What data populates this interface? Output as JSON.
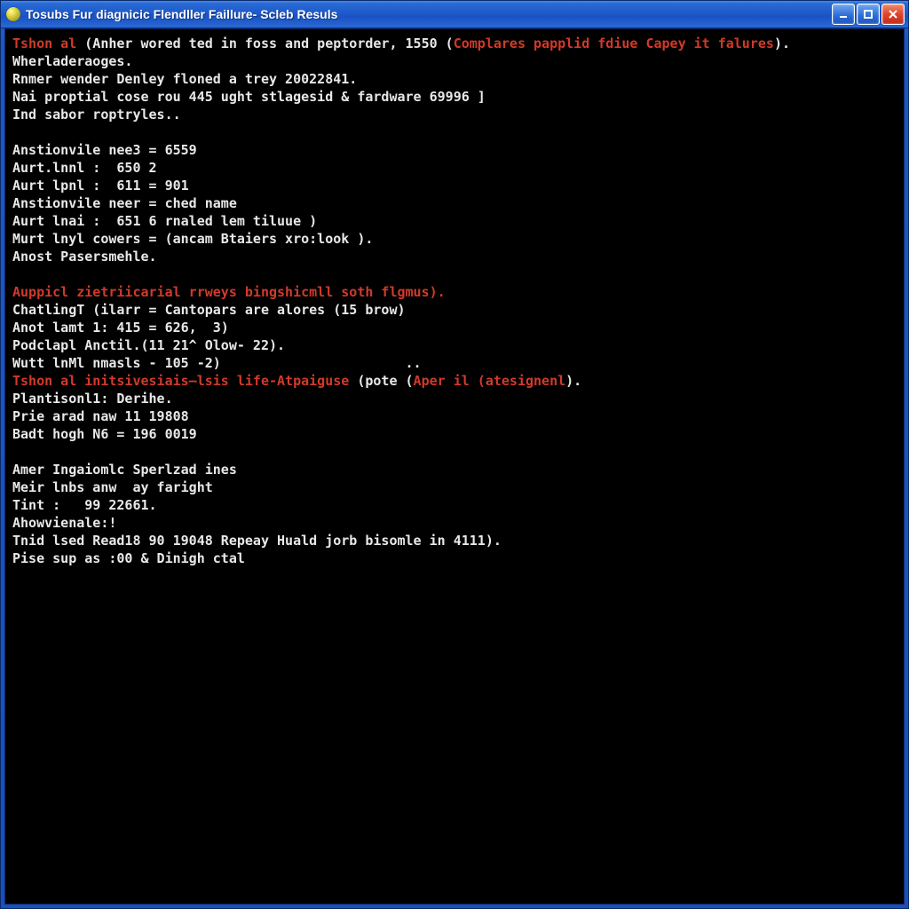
{
  "window": {
    "title": "Tosubs Fur diagnicic Flendller Faillure- Scleb Resuls"
  },
  "console": {
    "lines": [
      [
        {
          "color": "red",
          "text": "Tshon al "
        },
        {
          "color": "white",
          "text": "(Anher wored ted in foss and peptorder, 1550 ("
        },
        {
          "color": "red",
          "text": "Complares papplid fdiue Capey it falures"
        },
        {
          "color": "white",
          "text": ")."
        }
      ],
      [
        {
          "color": "white",
          "text": "Wherladeraoges."
        }
      ],
      [
        {
          "color": "white",
          "text": "Rnmer wender Denley floned a trey 20022841."
        }
      ],
      [
        {
          "color": "white",
          "text": "Nai proptial cose rou 445 ught stlagesid & fardware 69996 ]"
        }
      ],
      [
        {
          "color": "white",
          "text": "Ind sabor roptryles.."
        }
      ],
      [
        {
          "color": "white",
          "text": ""
        }
      ],
      [
        {
          "color": "white",
          "text": "Anstionvile nee3 = 6559"
        }
      ],
      [
        {
          "color": "white",
          "text": "Aurt.lnnl :  650 2"
        }
      ],
      [
        {
          "color": "white",
          "text": "Aurt lpnl :  611 = 901"
        }
      ],
      [
        {
          "color": "white",
          "text": "Anstionvile neer = ched name"
        }
      ],
      [
        {
          "color": "white",
          "text": "Aurt lnai :  651 6 rnaled lem tiluue )"
        }
      ],
      [
        {
          "color": "white",
          "text": "Murt lnyl cowers = (ancam Btaiers xro:look )."
        }
      ],
      [
        {
          "color": "white",
          "text": "Anost Pasersmehle."
        }
      ],
      [
        {
          "color": "white",
          "text": ""
        }
      ],
      [
        {
          "color": "red",
          "text": "Auppicl zietriicarial rrweys bingshicmll soth flgmus)."
        }
      ],
      [
        {
          "color": "white",
          "text": "ChatlingT (ilarr = Cantopars are alores (15 brow)"
        }
      ],
      [
        {
          "color": "white",
          "text": "Anot lamt 1: 415 = 626,  3)"
        }
      ],
      [
        {
          "color": "white",
          "text": "Podclapl Anctil.(11 21^ Olow- 22)."
        }
      ],
      [
        {
          "color": "white",
          "text": "Wutt lnMl nmasls - 105 -2)                       .."
        }
      ],
      [
        {
          "color": "red",
          "text": "Tshon al initsivesiais—lsis life-Atpaiguse "
        },
        {
          "color": "white",
          "text": "(pote ("
        },
        {
          "color": "red",
          "text": "Aper il (atesignenl"
        },
        {
          "color": "white",
          "text": ")."
        }
      ],
      [
        {
          "color": "white",
          "text": "Plantisonl1: Derihe."
        }
      ],
      [
        {
          "color": "white",
          "text": "Prie arad naw 11 19808"
        }
      ],
      [
        {
          "color": "white",
          "text": "Badt hogh N6 = 196 0019"
        }
      ],
      [
        {
          "color": "white",
          "text": ""
        }
      ],
      [
        {
          "color": "white",
          "text": "Amer Ingaiomlc Sperlzad ines"
        }
      ],
      [
        {
          "color": "white",
          "text": "Meir lnbs anw  ay faright"
        }
      ],
      [
        {
          "color": "white",
          "text": "Tint :   99 22661."
        }
      ],
      [
        {
          "color": "white",
          "text": "Ahowvienale:!"
        }
      ],
      [
        {
          "color": "white",
          "text": "Tnid lsed Read18 90 19048 Repeay Huald jorb bisomle in 4111)."
        }
      ],
      [
        {
          "color": "white",
          "text": "Pise sup as :00 & Dinigh ctal"
        }
      ]
    ]
  }
}
